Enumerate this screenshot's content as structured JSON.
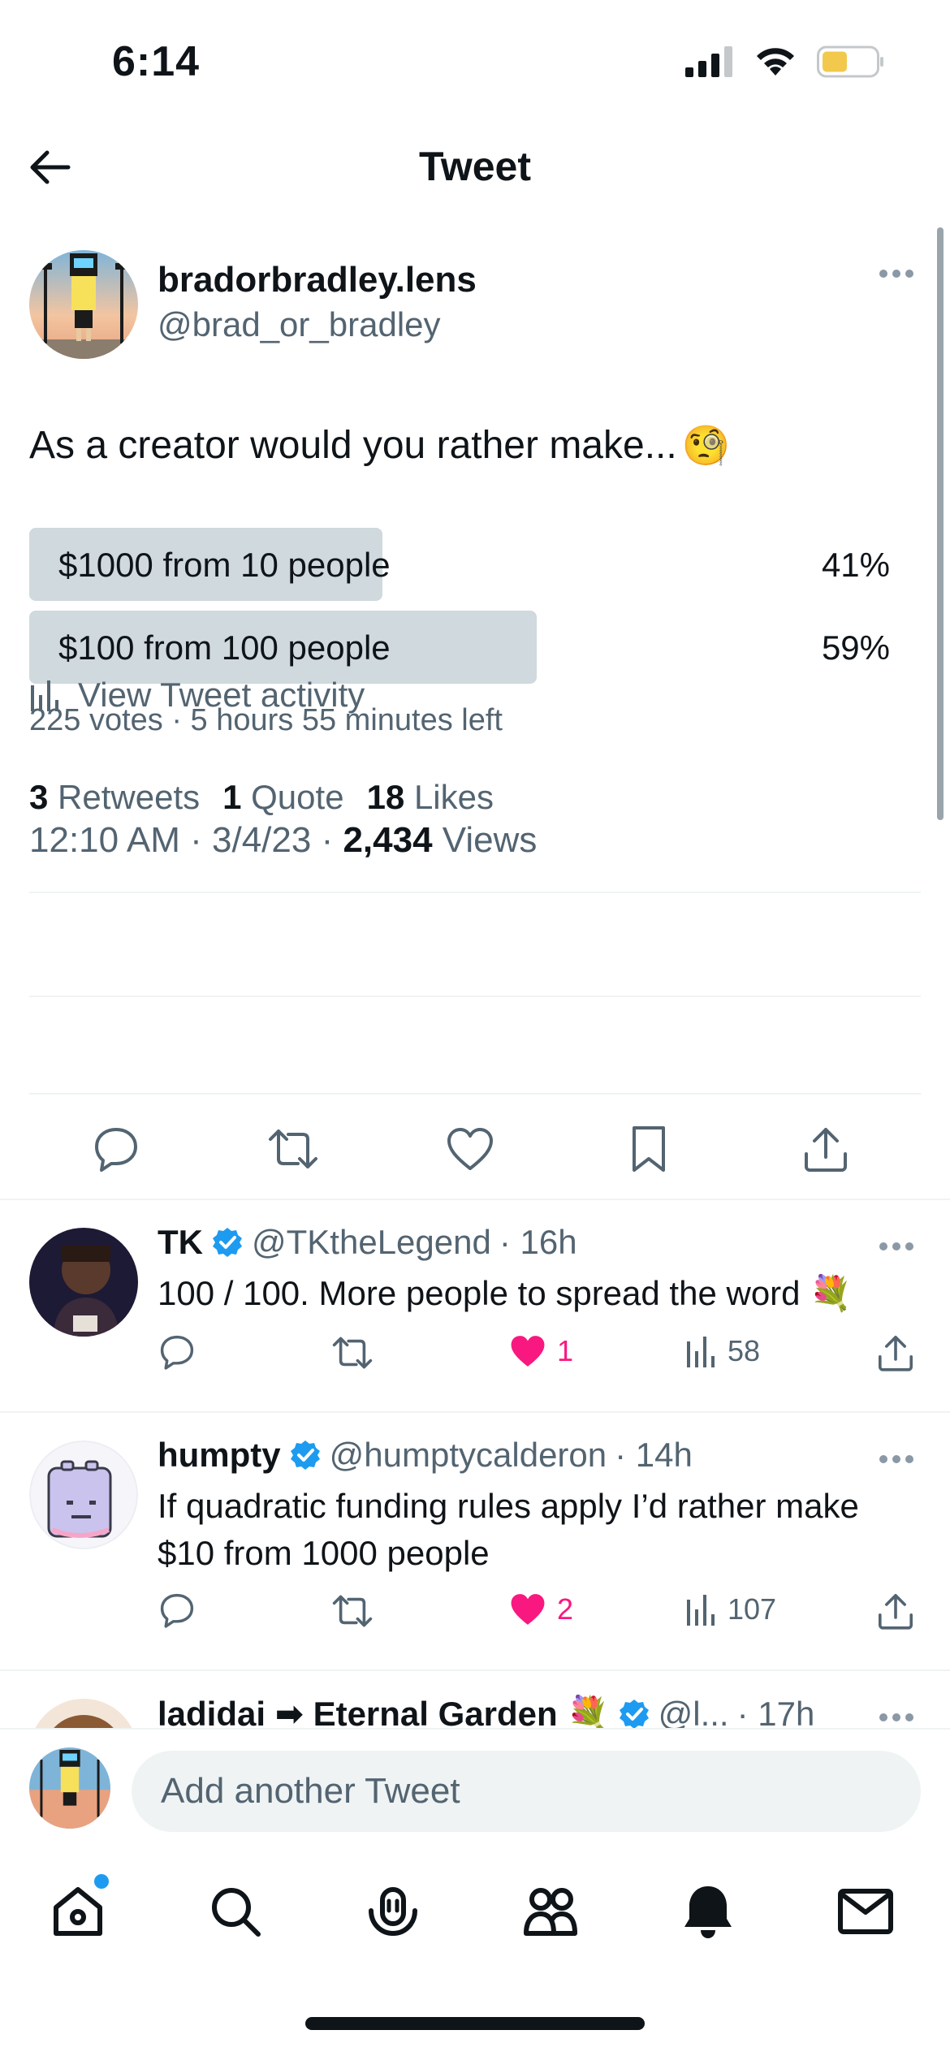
{
  "status_bar": {
    "time": "6:14"
  },
  "header": {
    "title": "Tweet"
  },
  "tweet": {
    "author_name": "bradorbradley.lens",
    "author_handle": "@brad_or_bradley",
    "text": "As a creator would you rather make...",
    "emoji": "🧐",
    "poll": {
      "options": [
        {
          "label": "$1000 from 10 people",
          "percent": "41%",
          "fill": 0.41
        },
        {
          "label": "$100 from 100 people",
          "percent": "59%",
          "fill": 0.59
        }
      ],
      "meta": "225 votes · 5 hours 55 minutes left"
    },
    "time": "12:10 AM · 3/4/23 · ",
    "views_count": "2,434",
    "views_label": " Views",
    "activity_label": "View Tweet activity",
    "retweets_count": "3",
    "retweets_label": "Retweets",
    "quotes_count": "1",
    "quotes_label": "Quote",
    "likes_count": "18",
    "likes_label": "Likes"
  },
  "replies": [
    {
      "name": "TK",
      "handle": "@TKtheLegend",
      "time": "· 16h",
      "text": "100 / 100. More people to spread the word 💐",
      "likes": "1",
      "views": "58"
    },
    {
      "name": "humpty",
      "handle": "@humptycalderon",
      "time": "· 14h",
      "text": "If quadratic funding rules apply I’d rather make $10 from 1000 people",
      "likes": "2",
      "views": "107"
    },
    {
      "name": "ladidai ➡ Eternal Garden 💐",
      "handle": "@l...",
      "time": "· 17h"
    }
  ],
  "composer": {
    "placeholder": "Add another Tweet"
  },
  "colors": {
    "accent": "#1d9bf0",
    "like": "#f91880",
    "muted": "#536471",
    "poll_bar": "#cfd9de"
  }
}
